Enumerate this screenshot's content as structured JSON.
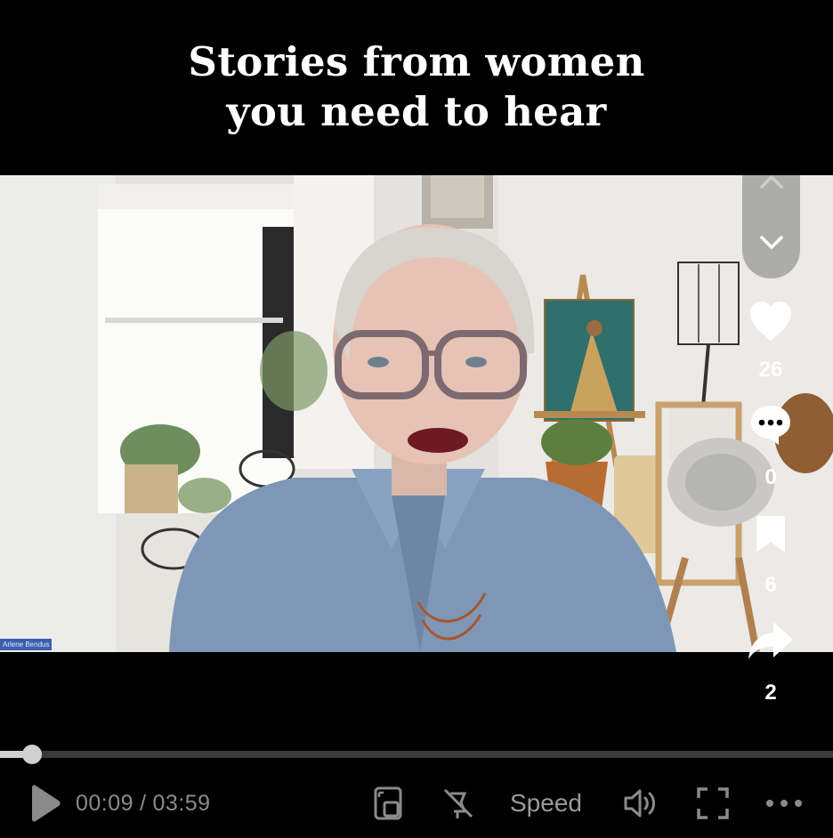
{
  "overlay": {
    "title_line1": "Stories from women",
    "title_line2": "you need to hear"
  },
  "video": {
    "participant_name": "Arlene Bendus"
  },
  "actions": {
    "likes": "26",
    "comments": "0",
    "saves": "6",
    "shares": "2"
  },
  "player": {
    "current_time": "00:09",
    "duration": "03:59",
    "separator": "/",
    "speed_label": "Speed",
    "progress_fraction": 0.038
  },
  "icons": {
    "play": "play-icon",
    "pip": "picture-in-picture-icon",
    "autoscroll": "autoscroll-off-icon",
    "volume": "volume-icon",
    "fullscreen": "fullscreen-icon",
    "more": "more-icon",
    "like": "heart-icon",
    "comment": "comment-icon",
    "save": "bookmark-icon",
    "share": "share-icon"
  }
}
